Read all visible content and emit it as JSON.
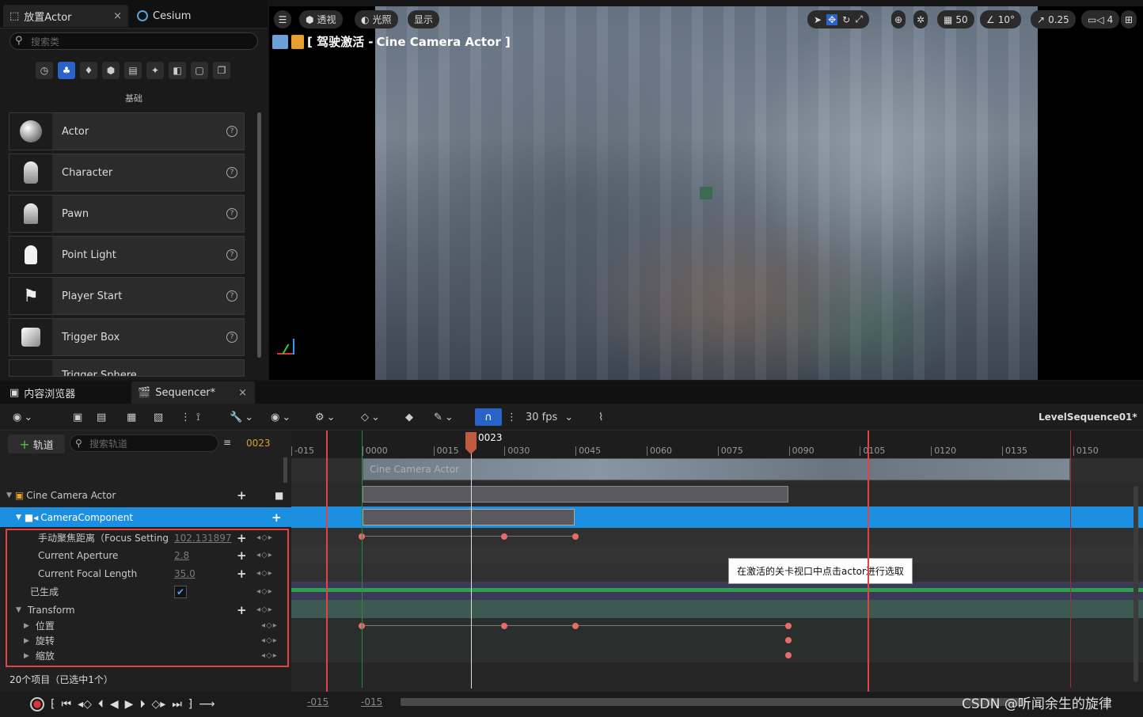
{
  "place_actors": {
    "tab_label": "放置Actor",
    "tab2_label": "Cesium",
    "search_placeholder": "搜索类",
    "category_label": "基础",
    "items": [
      {
        "label": "Actor"
      },
      {
        "label": "Character"
      },
      {
        "label": "Pawn"
      },
      {
        "label": "Point Light"
      },
      {
        "label": "Player Start"
      },
      {
        "label": "Trigger Box"
      },
      {
        "label": "Trigger Sphere"
      }
    ]
  },
  "viewport": {
    "perspective": "透视",
    "lighting": "光照",
    "show": "显示",
    "pilot_label": "[ 驾驶激活 - ",
    "pilot_actor": "Cine Camera Actor ]",
    "grid_value": "50",
    "angle_value": "10°",
    "scale_value": "0.25",
    "camera_speed": "4"
  },
  "bottom_tabs": {
    "content_browser": "内容浏览器",
    "sequencer": "Sequencer*"
  },
  "sequencer": {
    "fps": "30 fps",
    "sequence_name": "LevelSequence01*",
    "add_track": "轨道",
    "search_placeholder": "搜索轨道",
    "current_frame": "0023",
    "playhead_label": "0023",
    "status": "20个项目（已选中1个）",
    "tracks": {
      "cine": "Cine Camera Actor",
      "camera_component": "CameraComponent",
      "focus": "手动聚焦距离（Focus Setting",
      "focus_value": "102.131897",
      "aperture": "Current Aperture",
      "aperture_value": "2.8",
      "focal": "Current Focal Length",
      "focal_value": "35.0",
      "spawned": "已生成",
      "transform": "Transform",
      "location": "位置",
      "rotation": "旋转",
      "scale": "缩放"
    },
    "ticks": [
      "-015",
      "0000",
      "0015",
      "0030",
      "0045",
      "0060",
      "0075",
      "0090",
      "0105",
      "0120",
      "0135",
      "0150"
    ],
    "clip_label": "Cine Camera Actor",
    "tooltip": "在激活的关卡视口中点击actor进行选取",
    "range_start": "-015",
    "range_start2": "-015"
  },
  "watermark": "CSDN @听闻余生的旋律",
  "colors": {
    "accent": "#2a63c7",
    "selection": "#1d8fe0",
    "key": "#e86b6b",
    "highlight_box": "#e04545"
  }
}
